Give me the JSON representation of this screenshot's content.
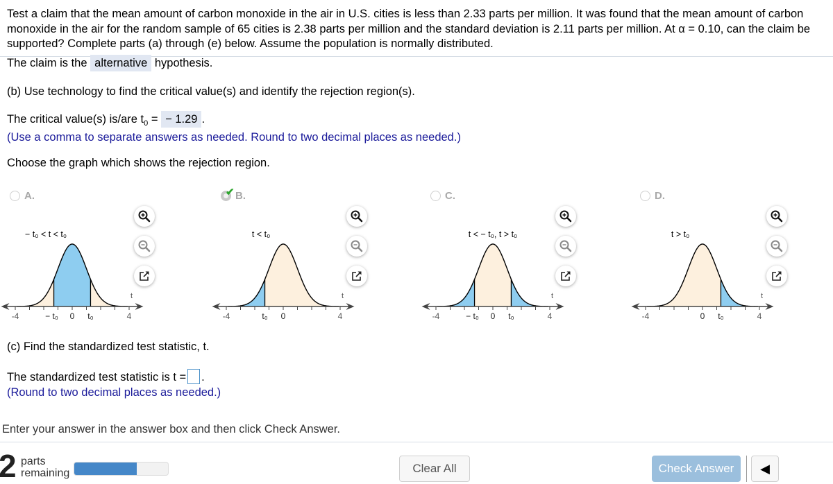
{
  "question": {
    "text": "Test a claim that the mean amount of carbon monoxide in the air in U.S. cities is less than 2.33 parts per million. It was found that the mean amount of carbon monoxide in the air for the random sample of 65 cities is 2.38 parts per million and the standard deviation is 2.11 parts per million. At α = 0.10, can the claim be supported? Complete parts (a) through (e) below. Assume the population is normally distributed."
  },
  "part_a": {
    "prefix": "The claim is the",
    "answer": "alternative",
    "suffix": "hypothesis."
  },
  "part_b": {
    "heading": "(b) Use technology to find the critical value(s) and identify the rejection region(s).",
    "critical_prefix": "The critical value(s) is/are t",
    "critical_sub": "0",
    "critical_eq": "=",
    "critical_answer": "− 1.29",
    "critical_suffix": ".",
    "hint": "(Use a comma to separate answers as needed. Round to two decimal places as needed.)",
    "choose": "Choose the graph which shows the rejection region."
  },
  "options": [
    {
      "letter": "A.",
      "selected": false,
      "correct": false,
      "region_label": "− t₀ < t < t₀",
      "shade": "middle",
      "ticks": [
        "-4",
        "− t₀",
        "0",
        "t₀",
        "4"
      ],
      "axis_label": "t"
    },
    {
      "letter": "B.",
      "selected": true,
      "correct": true,
      "region_label": "t < t₀",
      "shade": "left",
      "ticks": [
        "-4",
        "t₀",
        "0",
        "4"
      ],
      "axis_label": "t"
    },
    {
      "letter": "C.",
      "selected": false,
      "correct": false,
      "region_label": "t < − t₀, t > t₀",
      "shade": "both",
      "ticks": [
        "-4",
        "− t₀",
        "0",
        "t₀",
        "4"
      ],
      "axis_label": "t"
    },
    {
      "letter": "D.",
      "selected": false,
      "correct": false,
      "region_label": "t > t₀",
      "shade": "right",
      "ticks": [
        "-4",
        "0",
        "t₀",
        "4"
      ],
      "axis_label": "t"
    }
  ],
  "option_tools": {
    "zoom_in": "zoom-in-icon",
    "zoom_out": "zoom-out-icon",
    "popout": "popout-icon"
  },
  "part_c": {
    "heading": "(c) Find the standardized test statistic, t.",
    "stat_prefix": "The standardized test statistic is t =",
    "stat_value": "",
    "stat_suffix": ".",
    "hint": "(Round to two decimal places as needed.)"
  },
  "instruction": "Enter your answer in the answer box and then click Check Answer.",
  "footer": {
    "parts_count": "2",
    "parts_label_1": "parts",
    "parts_label_2": "remaining",
    "progress": 0.67,
    "clear_all": "Clear All",
    "check_answer": "Check Answer"
  },
  "colors": {
    "rejection": "#8ecdf0",
    "non_rejection": "#fdf0de",
    "hint_text": "#1a1a9a",
    "progress_fill": "#4587c8",
    "check_button": "#9bbfdd"
  }
}
